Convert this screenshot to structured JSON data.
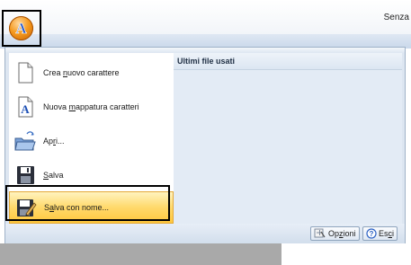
{
  "window": {
    "title": "Senza"
  },
  "app_button": {
    "letter": "A"
  },
  "menu": {
    "items": [
      {
        "pre": "Crea ",
        "key": "n",
        "post": "uovo carattere",
        "icon": "new-document-icon"
      },
      {
        "pre": "Nuova ",
        "key": "m",
        "post": "appatura caratteri",
        "icon": "character-map-icon"
      },
      {
        "pre": "Ap",
        "key": "r",
        "post": "i...",
        "icon": "open-folder-icon"
      },
      {
        "pre": "",
        "key": "S",
        "post": "alva",
        "icon": "save-icon"
      },
      {
        "pre": "S",
        "key": "a",
        "post": "lva con nome...",
        "icon": "save-as-icon"
      }
    ],
    "highlighted_index": 4
  },
  "recent": {
    "title": "Ultimi file usati"
  },
  "footer": {
    "options": {
      "pre": "Op",
      "key": "z",
      "post": "ioni"
    },
    "exit": {
      "pre": "Es",
      "key": "c",
      "post": "i"
    }
  }
}
